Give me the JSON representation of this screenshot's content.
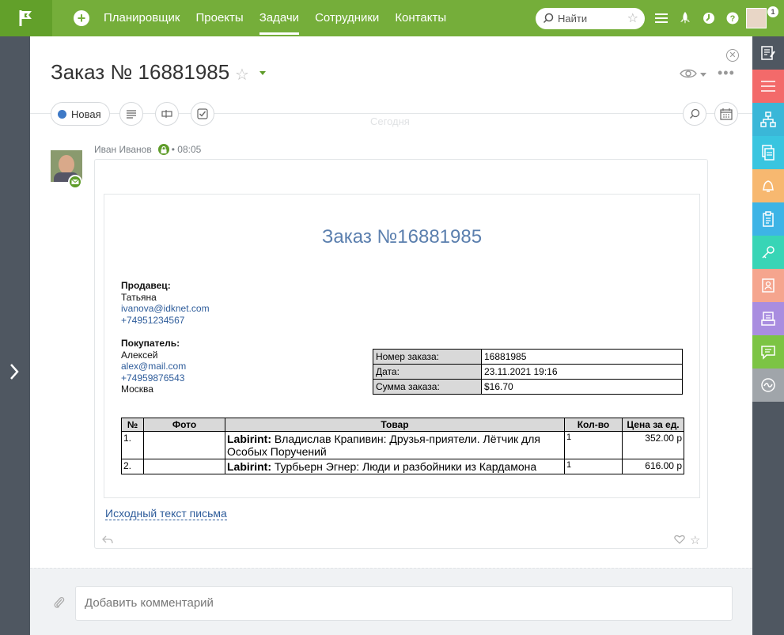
{
  "nav": {
    "items": [
      {
        "label": "Планировщик",
        "active": false
      },
      {
        "label": "Проекты",
        "active": false
      },
      {
        "label": "Задачи",
        "active": true
      },
      {
        "label": "Сотрудники",
        "active": false
      },
      {
        "label": "Контакты",
        "active": false
      }
    ],
    "search_placeholder": "Найти",
    "notification_count": "1"
  },
  "task": {
    "title": "Заказ № 16881985",
    "status": "Новая",
    "status_color": "#3e79c6",
    "today_label": "Сегодня"
  },
  "message": {
    "author": "Иван Иванов",
    "time": "08:05",
    "original_link": "Исходный текст письма"
  },
  "email": {
    "title": "Заказ №16881985",
    "seller": {
      "label": "Продавец:",
      "name": "Татьяна",
      "email": "ivanova@idknet.com",
      "phone": "+74951234567"
    },
    "buyer": {
      "label": "Покупатель:",
      "name": "Алексей",
      "email": "alex@mail.com",
      "phone": "+74959876543",
      "city": "Москва"
    },
    "info": [
      {
        "key": "Номер заказа:",
        "value": "16881985"
      },
      {
        "key": "Дата:",
        "value": "23.11.2021 19:16"
      },
      {
        "key": "Сумма заказа:",
        "value": "$16.70"
      }
    ],
    "columns": [
      "№",
      "Фото",
      "Товар",
      "Кол-во",
      "Цена за ед."
    ],
    "items": [
      {
        "num": "1.",
        "brand": "Labirint:",
        "product": "Владислав Крапивин: Друзья-приятели. Лётчик для Особых Поручений",
        "qty": "1",
        "price": "352.00 р"
      },
      {
        "num": "2.",
        "brand": "Labirint:",
        "product": "Турбьерн Эгнер: Люди и разбойники из Кардамона",
        "qty": "1",
        "price": "616.00 р"
      }
    ]
  },
  "comment": {
    "placeholder": "Добавить комментарий"
  },
  "right_strip_colors": [
    "#4f5761",
    "#f36a6a",
    "#3ab7d8",
    "#39c5e0",
    "#f7b870",
    "#3db4e6",
    "#38d5b6",
    "#f5a58e",
    "#a98de0",
    "#7cc444",
    "#a0a5aa"
  ],
  "accent_color": "#75ae3a"
}
